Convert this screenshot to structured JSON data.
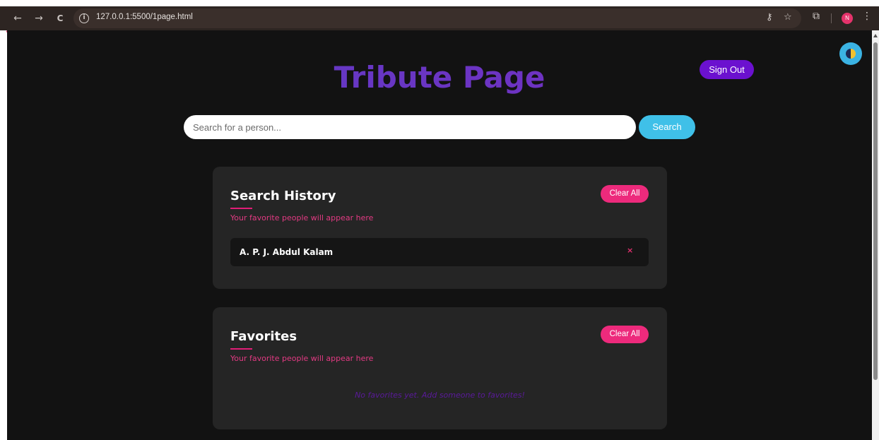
{
  "browser": {
    "back_icon": "←",
    "forward_icon": "→",
    "reload_icon": "C",
    "info_icon": "i",
    "url": "127.0.0.1:5500/1page.html",
    "key_icon": "⚷",
    "star_icon": "☆",
    "extensions_icon": "⧉",
    "profile_initial": "N",
    "menu_icon": "⋮"
  },
  "page": {
    "title": "Tribute Page",
    "sign_out_label": "Sign Out",
    "search": {
      "placeholder": "Search for a person...",
      "value": "",
      "button_label": "Search"
    },
    "history": {
      "title": "Search History",
      "subtitle": "Your favorite people will appear here",
      "clear_label": "Clear All",
      "items": [
        {
          "name": "A. P. J. Abdul Kalam",
          "remove_label": "×"
        }
      ]
    },
    "favorites": {
      "title": "Favorites",
      "subtitle": "Your favorite people will appear here",
      "clear_label": "Clear All",
      "empty_message": "No favorites yet. Add someone to favorites!"
    }
  },
  "colors": {
    "background": "#121212",
    "card": "#252525",
    "accent_pink": "#ed2a7c",
    "accent_purple": "#6b11cf",
    "accent_cyan": "#3fc0e8"
  }
}
